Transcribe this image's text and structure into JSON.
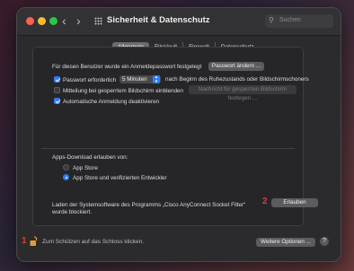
{
  "window": {
    "title": "Sicherheit & Datenschutz",
    "search_placeholder": "Suchen",
    "back_glyph": "‹",
    "forward_glyph": "›"
  },
  "tabs": [
    {
      "label": "Allgemein",
      "active": true
    },
    {
      "label": "FileVault",
      "active": false
    },
    {
      "label": "Firewall",
      "active": false
    },
    {
      "label": "Datenschutz",
      "active": false
    }
  ],
  "general": {
    "login_password_text": "Für diesen Benutzer wurde ein Anmeldepasswort festgelegt",
    "change_password_button": "Passwort ändern ...",
    "require_password_label": "Passwort erforderlich",
    "require_password_checked": true,
    "require_password_value": "5 Minuten",
    "require_password_suffix": "nach Beginn des Ruhezustands oder Bildschirmschoners",
    "lock_message_label": "Mitteilung bei gesperrtem Bildschirm einblenden",
    "lock_message_checked": false,
    "lock_message_button": "Nachricht für gesperrten Bildschirm festlegen ...",
    "auto_login_label": "Automatische Anmeldung deaktivieren",
    "auto_login_checked": true
  },
  "apps_download": {
    "heading": "Apps-Download erlauben von:",
    "options": [
      {
        "label": "App Store",
        "selected": false
      },
      {
        "label": "App Store und verifizierten Entwickler",
        "selected": true
      }
    ]
  },
  "blocked": {
    "text_line1": "Laden der Systemsoftware des Programms „Cisco AnyConnect Socket Filter“",
    "text_line2": "wurde blockiert.",
    "allow_button": "Erlauben",
    "marker": "2"
  },
  "footer": {
    "lock_text": "Zum Schützen auf das Schloss klicken.",
    "more_options_button": "Weitere Optionen ...",
    "help_glyph": "?",
    "marker": "1"
  },
  "colors": {
    "accent": "#2f7cf6",
    "marker": "#e23b30",
    "lock": "#e0a030"
  }
}
